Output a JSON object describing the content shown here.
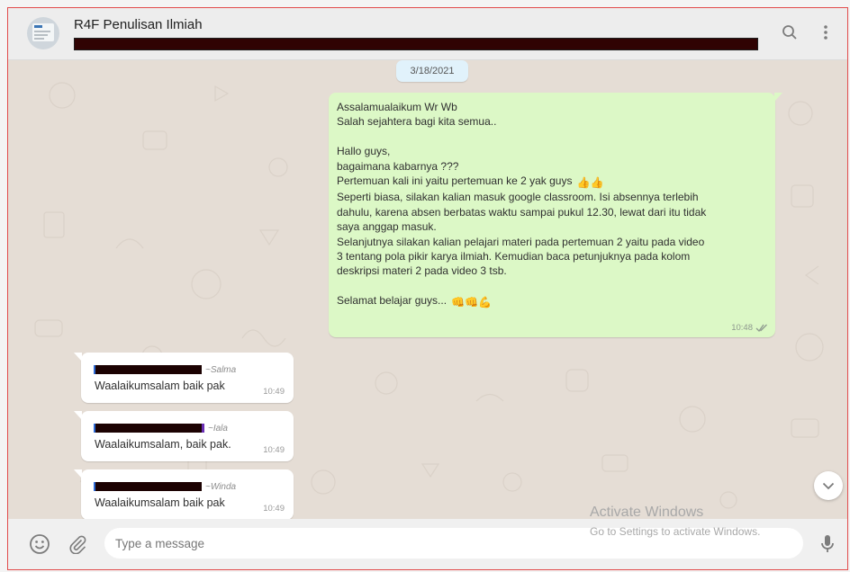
{
  "header": {
    "title": "R4F Penulisan Ilmiah",
    "avatar_icon": "document-thumbnail-icon",
    "search_icon": "search-icon",
    "menu_icon": "kebab-menu-icon"
  },
  "conversation": {
    "date_chip": "3/18/2021",
    "outgoing": {
      "lines": [
        "Assalamualaikum Wr Wb",
        "Salah sejahtera bagi kita semua..",
        "",
        "Hallo guys,",
        "bagaimana kabarnya ???",
        "Pertemuan kali ini yaitu pertemuan ke 2 yak guys",
        "Seperti biasa, silakan kalian masuk google classroom. Isi absennya terlebih",
        "dahulu, karena absen berbatas waktu sampai pukul 12.30, lewat dari itu tidak",
        "saya anggap masuk.",
        "Selanjutnya silakan kalian pelajari materi pada pertemuan 2 yaitu pada video",
        "3 tentang pola pikir karya ilmiah. Kemudian baca petunjuknya pada kolom",
        "deskripsi materi 2 pada video 3 tsb.",
        "",
        "Selamat belajar guys..."
      ],
      "emoji_thumbs": "👍👍",
      "emoji_fists": "👊👊💪",
      "time": "10:48",
      "status_icon": "double-check-icon"
    },
    "incoming": [
      {
        "sender": "~Salma",
        "text": "Waalaikumsalam baik pak",
        "time": "10:49"
      },
      {
        "sender": "~Iala",
        "text": "Waalaikumsalam, baik pak.",
        "time": "10:49"
      },
      {
        "sender": "~Winda",
        "text": "Waalaikumsalam baik pak",
        "time": "10:49"
      }
    ]
  },
  "composer": {
    "placeholder": "Type a message",
    "emoji_icon": "emoji-icon",
    "attach_icon": "paperclip-icon",
    "mic_icon": "microphone-icon"
  },
  "watermark": {
    "title": "Activate Windows",
    "subtitle": "Go to Settings to activate Windows."
  },
  "colors": {
    "outgoing_bubble": "#dcf8c6",
    "chat_background": "#e5ddd5",
    "header_background": "#ededed",
    "date_chip": "#e1f2fb"
  }
}
